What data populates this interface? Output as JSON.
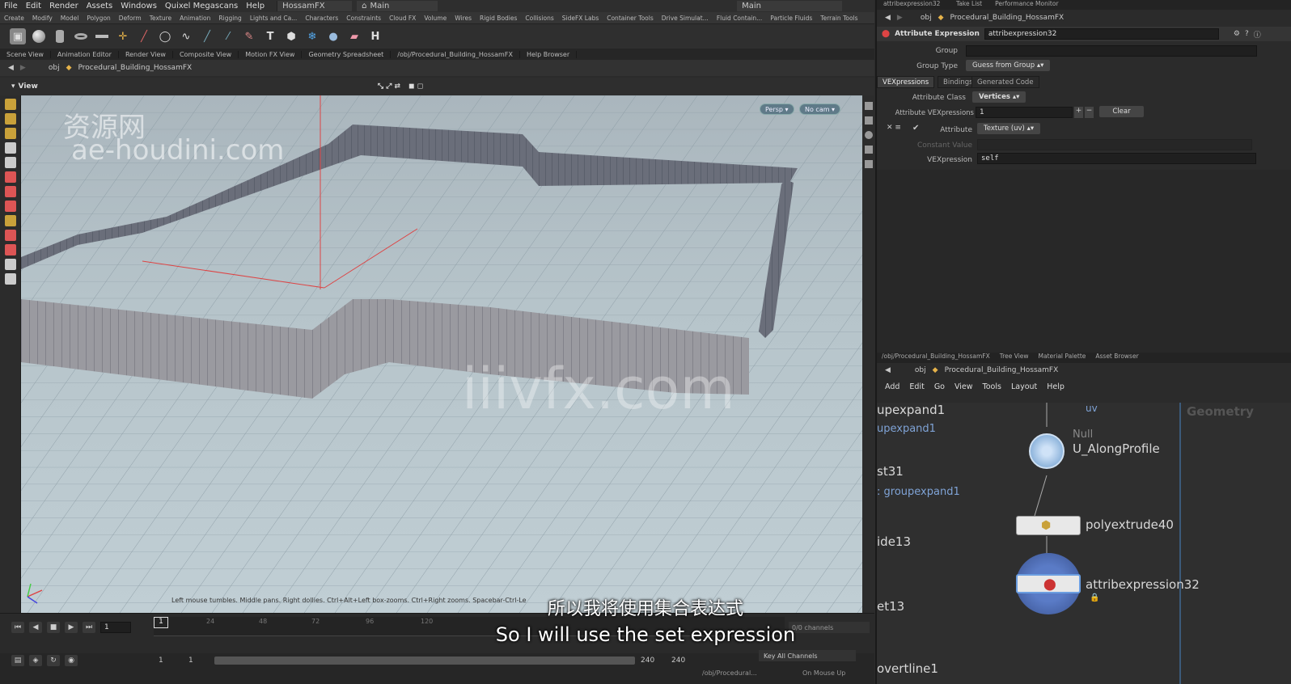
{
  "menubar": {
    "items": [
      "File",
      "Edit",
      "Render",
      "Assets",
      "Windows",
      "Quixel Megascans",
      "Help"
    ],
    "desktop": "HossamFX",
    "network": "Main",
    "main2": "Main"
  },
  "shelf_tabs": [
    "Create",
    "Modify",
    "Model",
    "Polygon",
    "Deform",
    "Texture",
    "Animation",
    "Rigging",
    "Lights and Ca...",
    "Characters",
    "Constraints",
    "Cloud FX",
    "Volume",
    "Wires",
    "Rigid Bodies",
    "Collisions",
    "SideFX Labs",
    "Container Tools",
    "Drive Simulat...",
    "Fluid Contain...",
    "Particle Fluids",
    "Terrain Tools"
  ],
  "pane_tabs": [
    "Scene View",
    "Animation Editor",
    "Render View",
    "Composite View",
    "Motion FX View",
    "Geometry Spreadsheet",
    "/obj/Procedural_Building_HossamFX",
    "Help Browser"
  ],
  "path": {
    "obj": "obj",
    "node": "Procedural_Building_HossamFX"
  },
  "viewer": {
    "title": "View",
    "persp": "Persp",
    "cam": "No cam",
    "hint": "Left mouse tumbles. Middle pans. Right dollies. Ctrl+Alt+Left box-zooms. Ctrl+Right zooms. Spacebar-Ctrl-Le"
  },
  "watermarks": {
    "cn": "资源网",
    "url": "ae-houdini.com",
    "center": "iiivfx.com"
  },
  "timeline": {
    "frame": "1",
    "marker": "1",
    "ticks": [
      "24",
      "48",
      "72",
      "96",
      "120"
    ],
    "start1": "1",
    "start2": "1",
    "end1": "240",
    "end2": "240",
    "channels": "0/0 channels",
    "key_all": "Key All Channels"
  },
  "status": {
    "path": "/obj/Procedural...",
    "mouse": "On Mouse Up"
  },
  "top_right_tabs": [
    "attribexpression32",
    "Take List",
    "Performance Monitor"
  ],
  "params": {
    "type": "Attribute Expression",
    "name": "attribexpression32",
    "group_label": "Group",
    "group_value": "",
    "group_type_label": "Group Type",
    "group_type_value": "Guess from Group",
    "tabs": [
      "VEXpressions",
      "Bindings",
      "Generated Code"
    ],
    "attr_class_label": "Attribute Class",
    "attr_class_value": "Vertices",
    "attr_vex_label": "Attribute VEXpressions",
    "attr_vex_value": "1",
    "clear": "Clear",
    "attribute_label": "Attribute",
    "attribute_value": "Texture (uv)",
    "constant_label": "Constant Value",
    "vexpr_label": "VEXpression",
    "vexpr_value": "self"
  },
  "net_tabs": [
    "/obj/Procedural_Building_HossamFX",
    "Tree View",
    "Material Palette",
    "Asset Browser"
  ],
  "net_menu": [
    "Add",
    "Edit",
    "Go",
    "View",
    "Tools",
    "Layout",
    "Help"
  ],
  "net": {
    "path": "Procedural_Building_HossamFX",
    "labels": {
      "a": "upexpand1",
      "b": "upexpand1",
      "c": "st31",
      "d": ": groupexpand1",
      "e": "ide13",
      "f": "et13",
      "g": "overtline1"
    },
    "uv": "uv",
    "null_type": "Null",
    "null_name": "U_AlongProfile",
    "poly": "polyextrude40",
    "attrib": "attribexpression32",
    "geometry": "Geometry"
  },
  "subtitles": {
    "cn": "所以我将使用集合表达式",
    "en": "So I will use the set expression"
  },
  "colors": {
    "accent": "#6a9de0",
    "viewport": "#b6c4ca"
  }
}
